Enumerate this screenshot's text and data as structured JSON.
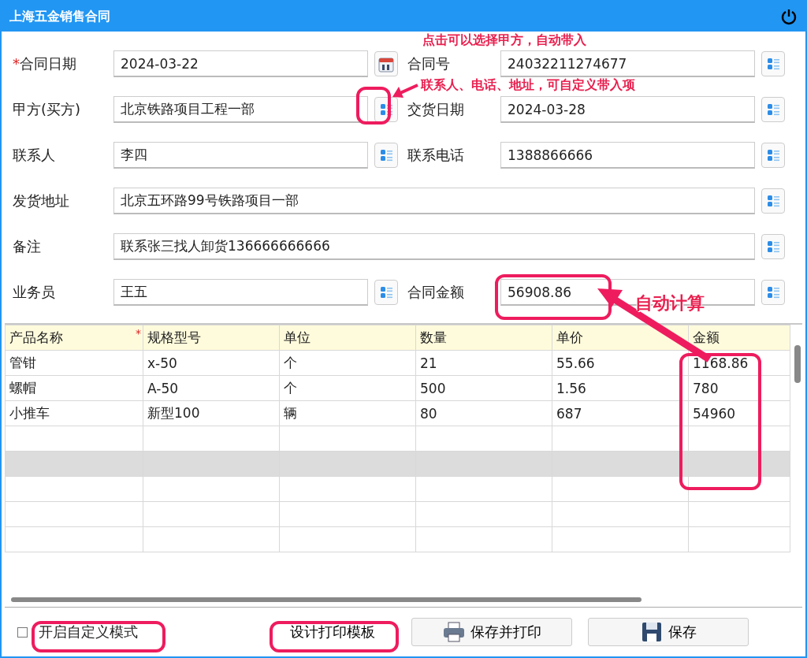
{
  "window": {
    "title": "上海五金销售合同"
  },
  "form": {
    "rows": [
      {
        "kind": "pair",
        "fields": [
          {
            "required_mark": "*",
            "label": "合同日期",
            "value": "2024-03-22",
            "kind": "date"
          },
          {
            "label": "合同号",
            "value": "24032211274677",
            "kind": "lookup"
          }
        ]
      },
      {
        "kind": "pair",
        "fields": [
          {
            "label": "甲方(买方)",
            "value": "北京铁路项目工程一部",
            "kind": "lookup"
          },
          {
            "label": "交货日期",
            "value": "2024-03-28",
            "kind": "lookup"
          }
        ]
      },
      {
        "kind": "pair",
        "fields": [
          {
            "label": "联系人",
            "value": "李四",
            "kind": "lookup"
          },
          {
            "label": "联系电话",
            "value": "1388866666",
            "kind": "lookup"
          }
        ]
      },
      {
        "kind": "full",
        "fields": [
          {
            "label": "发货地址",
            "value": "北京五环路99号铁路项目一部",
            "kind": "lookup"
          }
        ]
      },
      {
        "kind": "full",
        "fields": [
          {
            "label": "备注",
            "value": "联系张三找人卸货136666666666",
            "kind": "lookup"
          }
        ]
      },
      {
        "kind": "pair",
        "fields": [
          {
            "label": "业务员",
            "value": "王五",
            "kind": "lookup"
          },
          {
            "label": "合同金额",
            "value": "56908.86",
            "kind": "lookup"
          }
        ]
      }
    ]
  },
  "table": {
    "columns": [
      {
        "label": "产品名称",
        "required_mark": "*"
      },
      {
        "label": "规格型号"
      },
      {
        "label": "单位"
      },
      {
        "label": "数量"
      },
      {
        "label": "单价"
      },
      {
        "label": "金额"
      }
    ],
    "rows": [
      {
        "cells": [
          "管钳",
          "x-50",
          "个",
          "21",
          "55.66",
          "1168.86"
        ],
        "selected": false
      },
      {
        "cells": [
          "螺帽",
          "A-50",
          "个",
          "500",
          "1.56",
          "780"
        ],
        "selected": false
      },
      {
        "cells": [
          "小推车",
          "新型100",
          "辆",
          "80",
          "687",
          "54960"
        ],
        "selected": false
      },
      {
        "cells": [],
        "selected": false
      },
      {
        "cells": [],
        "selected": true
      },
      {
        "cells": [],
        "selected": false
      },
      {
        "cells": [],
        "selected": false
      },
      {
        "cells": [],
        "selected": false
      }
    ]
  },
  "footer": {
    "custom_mode": {
      "label": "开启自定义模式",
      "checked": false
    },
    "buttons": [
      {
        "label": "设计打印模板",
        "kind": "flat"
      },
      {
        "label": "保存并打印",
        "kind": "print"
      },
      {
        "label": "保存",
        "kind": "save"
      }
    ]
  },
  "annotations": [
    {
      "text": "点击可以选择甲方，自动带入"
    },
    {
      "text": "联系人、电话、地址，可自定义带入项"
    },
    {
      "text": "自动计算"
    }
  ]
}
